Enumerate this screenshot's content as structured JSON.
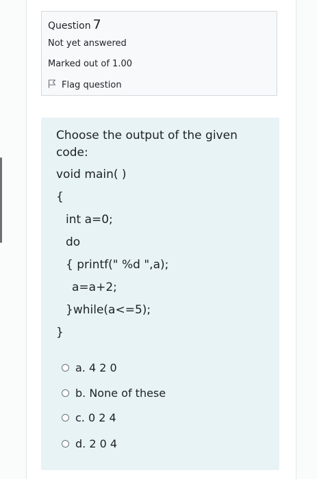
{
  "question": {
    "label": "Question",
    "number": "7",
    "status": "Not yet answered",
    "marks": "Marked out of 1.00",
    "flag_label": "Flag question"
  },
  "prompt": {
    "line1": "Choose the output of the given",
    "line2": "code:",
    "code": [
      "void main( )",
      "{",
      "int a=0;",
      "do",
      "{ printf(\" %d \",a);",
      "a=a+2;",
      "}while(a<=5);",
      "}"
    ]
  },
  "options": [
    {
      "label": "a. 4 2 0"
    },
    {
      "label": "b. None of these"
    },
    {
      "label": "c. 0 2 4"
    },
    {
      "label": "d. 2 0 4"
    }
  ]
}
